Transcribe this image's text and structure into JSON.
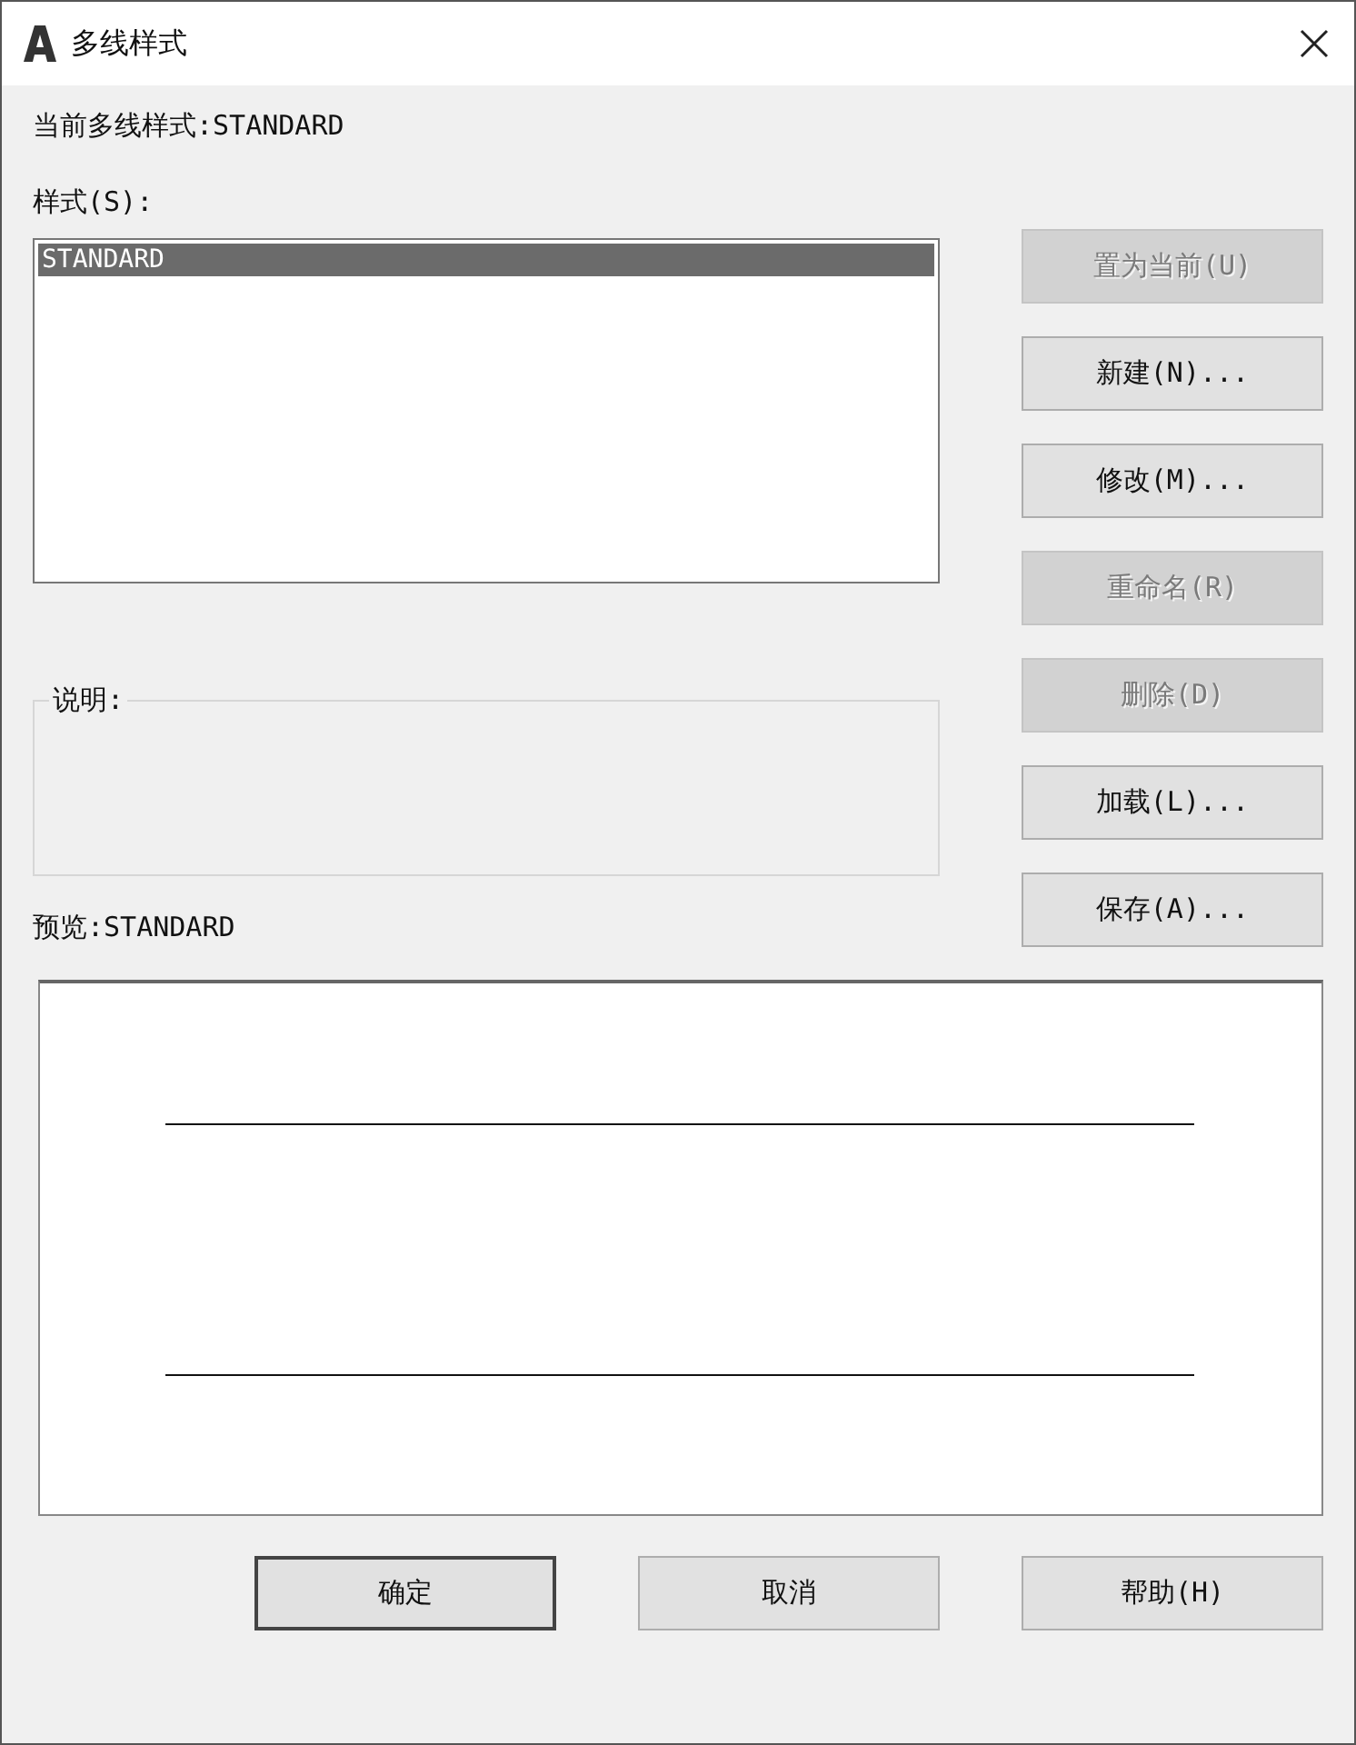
{
  "window": {
    "title": "多线样式"
  },
  "current_style_label": "当前多线样式:STANDARD",
  "styles_label": "样式(S):",
  "styles": [
    {
      "label": "STANDARD",
      "selected": true
    }
  ],
  "description": {
    "legend": "说明:"
  },
  "preview_label": "预览:STANDARD",
  "side_buttons": [
    {
      "label": "置为当前(U)",
      "disabled": true
    },
    {
      "label": "新建(N)...",
      "disabled": false
    },
    {
      "label": "修改(M)...",
      "disabled": false
    },
    {
      "label": "重命名(R)",
      "disabled": true
    },
    {
      "label": "删除(D)",
      "disabled": true
    },
    {
      "label": "加载(L)...",
      "disabled": false
    },
    {
      "label": "保存(A)...",
      "disabled": false
    }
  ],
  "bottom_buttons": [
    {
      "label": "确定",
      "default": true
    },
    {
      "label": "取消",
      "default": false
    },
    {
      "label": "帮助(H)",
      "default": false
    }
  ]
}
